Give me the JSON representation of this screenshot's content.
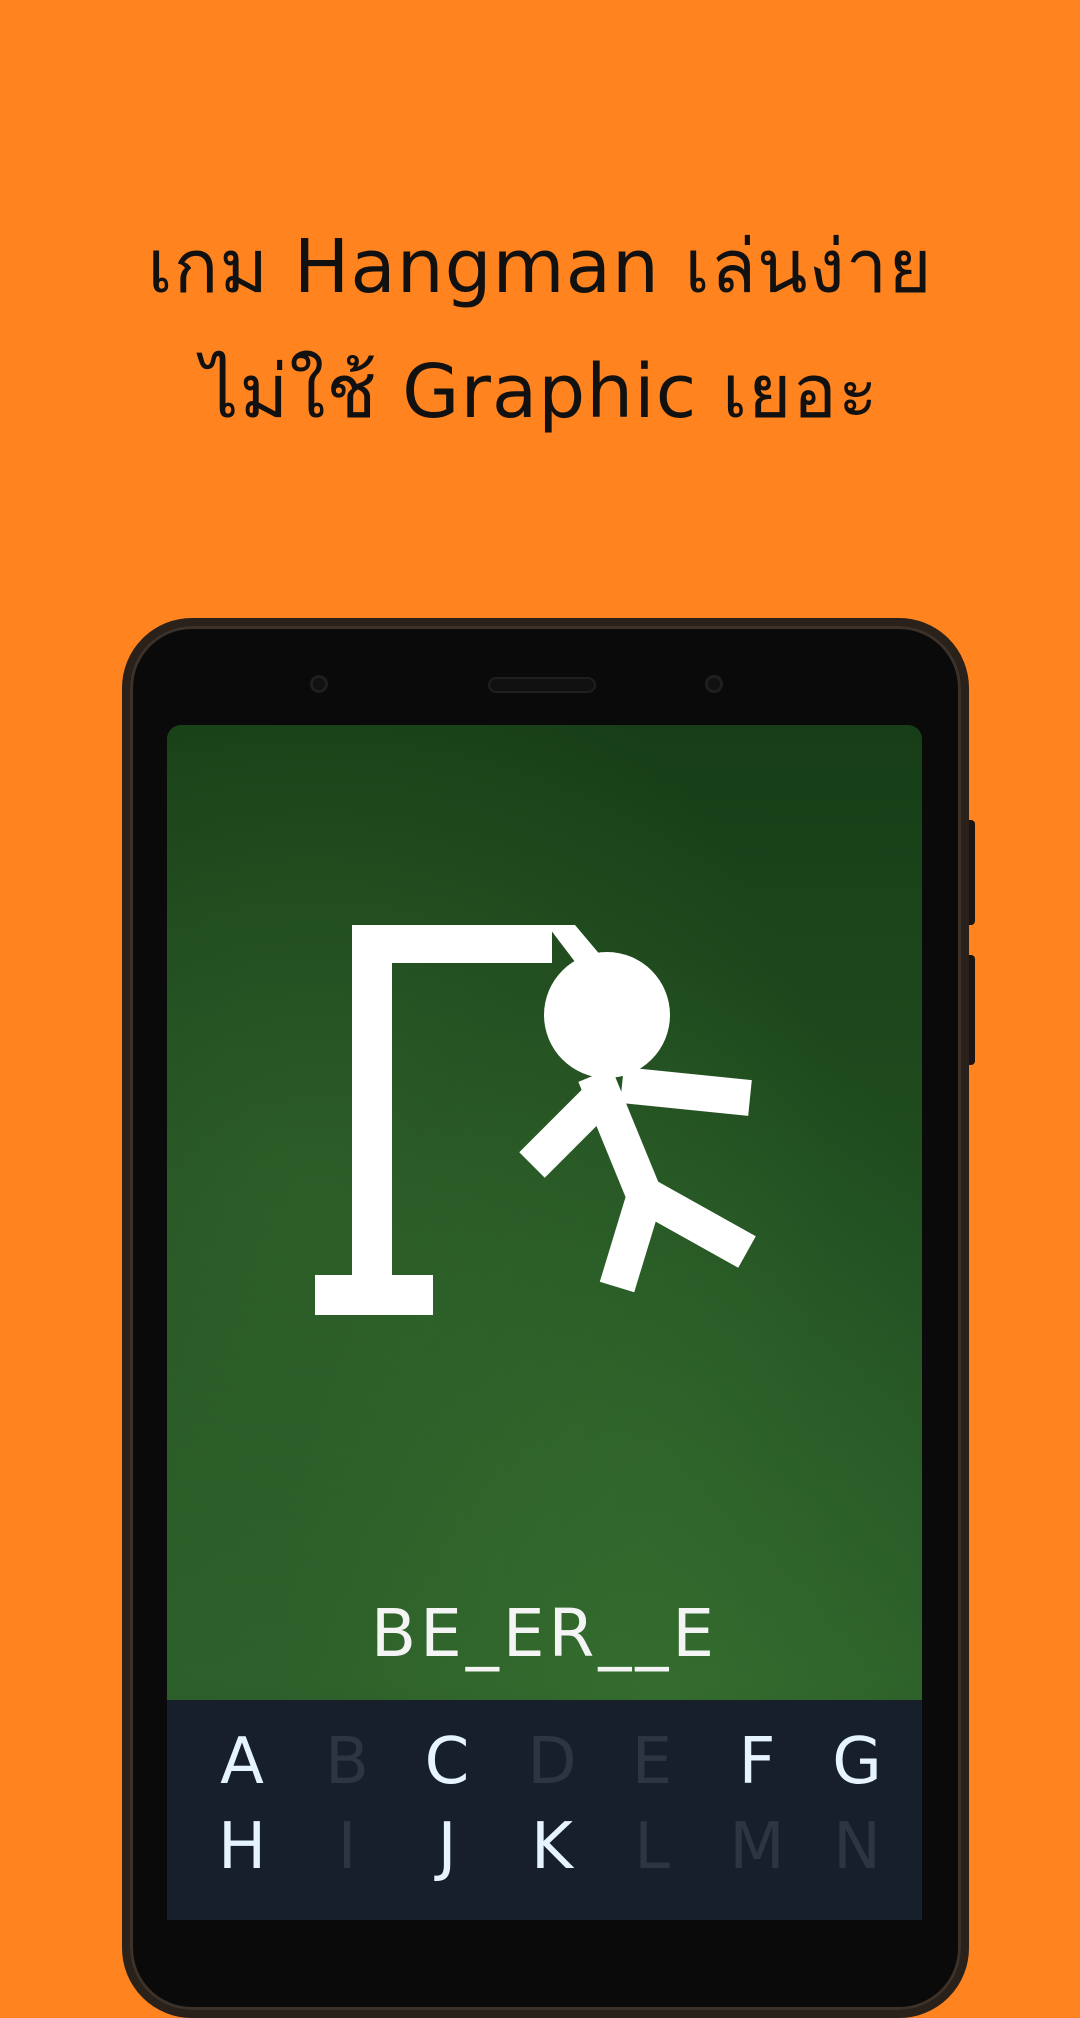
{
  "headline": {
    "line1": "เกม Hangman เล่นง่าย",
    "line2": "ไม่ใช้ Graphic เยอะ"
  },
  "game": {
    "word_display": "BE_ER__E",
    "keyboard": {
      "row1": [
        {
          "letter": "A",
          "enabled": true
        },
        {
          "letter": "B",
          "enabled": false
        },
        {
          "letter": "C",
          "enabled": true
        },
        {
          "letter": "D",
          "enabled": false
        },
        {
          "letter": "E",
          "enabled": false
        },
        {
          "letter": "F",
          "enabled": true
        },
        {
          "letter": "G",
          "enabled": true
        }
      ],
      "row2": [
        {
          "letter": "H",
          "enabled": true
        },
        {
          "letter": "I",
          "enabled": false
        },
        {
          "letter": "J",
          "enabled": true
        },
        {
          "letter": "K",
          "enabled": true
        },
        {
          "letter": "L",
          "enabled": false
        },
        {
          "letter": "M",
          "enabled": false
        },
        {
          "letter": "N",
          "enabled": false
        }
      ]
    }
  },
  "colors": {
    "background": "#ff831e",
    "board": "#245424",
    "keyboard": "#17202a",
    "key_enabled": "#e6f4ff",
    "key_disabled": "#2c3540"
  }
}
